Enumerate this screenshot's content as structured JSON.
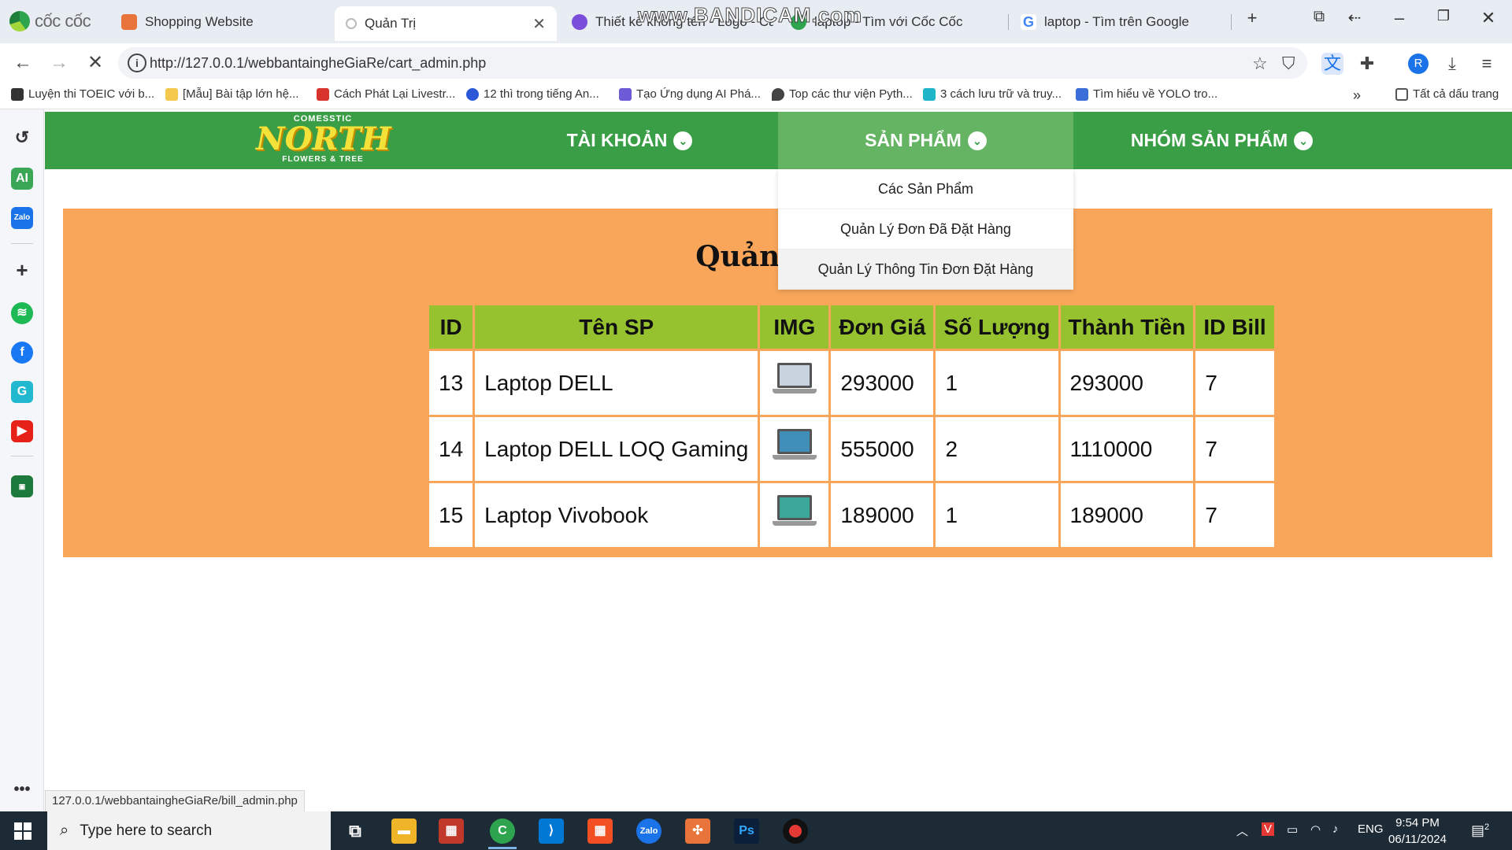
{
  "browser": {
    "brand": "cốc cốc",
    "tabs": [
      {
        "title": "Shopping Website",
        "color": "#e8743b"
      },
      {
        "title": "Quản Trị",
        "color": "#cccccc",
        "active": true
      },
      {
        "title": "Thiết kế không tên - Logo - Car",
        "color": "#7b4ddb"
      },
      {
        "title": "laptop - Tìm với Cốc Cốc",
        "color": "#2ea44f"
      },
      {
        "title": "laptop - Tìm trên Google",
        "color": "#4285f4"
      }
    ],
    "new_tab": "+",
    "watermark": "www.BANDICAM.com",
    "url": "http://127.0.0.1/webbantaingheGiaRe/cart_admin.php",
    "profile_initial": "R",
    "bookmarks": [
      "Luyện thi TOEIC với b...",
      "[Mẫu] Bài tập lớn hệ...",
      "Cách Phát Lại Livestr...",
      "12 thì trong tiếng An...",
      "Tạo Ứng dụng AI Phá...",
      "Top các thư viện Pyth...",
      "3 cách lưu trữ và truy...",
      "Tìm hiểu về YOLO tro..."
    ],
    "all_bookmarks": "Tất cả dấu trang",
    "status_url": "127.0.0.1/webbantaingheGiaRe/bill_admin.php"
  },
  "site": {
    "logo": {
      "top": "COMESSTIC",
      "main": "NORTH",
      "bottom": "FLOWERS & TREE"
    },
    "nav": [
      {
        "label": "TÀI KHOẢN"
      },
      {
        "label": "SẢN PHẨM"
      },
      {
        "label": "NHÓM SẢN PHẨM"
      }
    ],
    "dropdown": [
      "Các Sản Phẩm",
      "Quản Lý Đơn Đã Đặt Hàng",
      "Quản Lý Thông Tin Đơn Đặt Hàng"
    ],
    "page_title": "Quản Lý Đ",
    "colors": {
      "nav_green": "#3a9e46",
      "panel_orange": "#f9a65b",
      "header_green": "#95c22e"
    }
  },
  "table": {
    "headers": [
      "ID",
      "Tên SP",
      "IMG",
      "Đơn Giá",
      "Số Lượng",
      "Thành Tiền",
      "ID Bill"
    ],
    "rows": [
      {
        "id": "13",
        "name": "Laptop DELL",
        "img": "laptop-icon",
        "price": "293000",
        "qty": "1",
        "total": "293000",
        "bill": "7"
      },
      {
        "id": "14",
        "name": "Laptop DELL LOQ Gaming",
        "img": "laptop-icon",
        "price": "555000",
        "qty": "2",
        "total": "1110000",
        "bill": "7"
      },
      {
        "id": "15",
        "name": "Laptop Vivobook",
        "img": "laptop-icon",
        "price": "189000",
        "qty": "1",
        "total": "189000",
        "bill": "7"
      }
    ]
  },
  "taskbar": {
    "search_placeholder": "Type here to search",
    "lang": "ENG",
    "time": "9:54 PM",
    "date": "06/11/2024",
    "notifications": "2"
  }
}
